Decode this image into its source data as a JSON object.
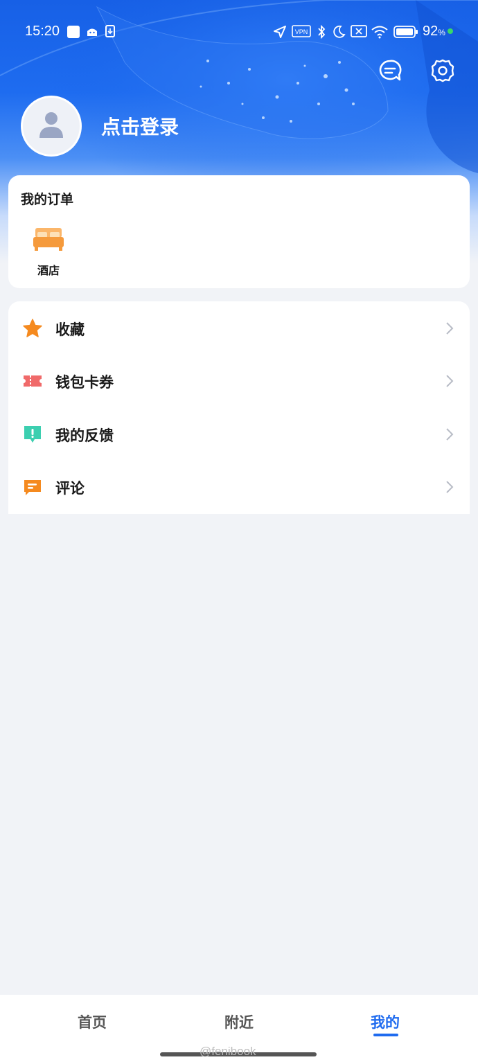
{
  "status_bar": {
    "time": "15:20",
    "battery_percent": "92",
    "battery_unit": "%",
    "icons": [
      "notification-square-icon",
      "android-icon",
      "download-icon",
      "location-arrow-icon",
      "vpn-icon",
      "bluetooth-icon",
      "moon-icon",
      "sim-off-icon",
      "wifi-icon",
      "battery-icon"
    ]
  },
  "header": {
    "login_text": "点击登录",
    "message_icon": "message-icon",
    "settings_icon": "gear-icon"
  },
  "orders": {
    "title": "我的订单",
    "items": [
      {
        "label": "酒店",
        "icon": "bed-icon"
      }
    ]
  },
  "menu": {
    "items": [
      {
        "label": "收藏",
        "icon": "star-icon",
        "color": "#f58a1f"
      },
      {
        "label": "钱包卡券",
        "icon": "ticket-icon",
        "color": "#f06a6a"
      },
      {
        "label": "我的反馈",
        "icon": "feedback-icon",
        "color": "#3ccfb0"
      },
      {
        "label": "评论",
        "icon": "comment-icon",
        "color": "#f58a1f"
      }
    ]
  },
  "tabbar": {
    "tabs": [
      {
        "label": "首页",
        "active": false
      },
      {
        "label": "附近",
        "active": false
      },
      {
        "label": "我的",
        "active": true
      }
    ]
  },
  "watermark": "@fenibook",
  "colors": {
    "accent": "#1f6bef",
    "hero": "#1e6cf0",
    "background": "#f1f3f7"
  }
}
